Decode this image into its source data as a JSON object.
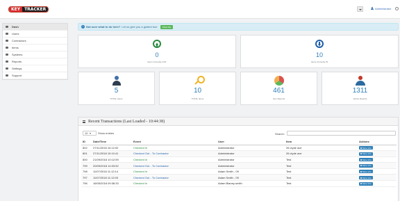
{
  "header": {
    "logo_part1": "KEY",
    "logo_part2": "TRACKER",
    "user": "Administrator"
  },
  "sidebar": {
    "items": [
      {
        "label": "Dash",
        "icon": "home-icon"
      },
      {
        "label": "Users",
        "icon": "user-icon"
      },
      {
        "label": "Contractors",
        "icon": "contractor-icon"
      },
      {
        "label": "Items",
        "icon": "key-icon"
      },
      {
        "label": "Systems",
        "icon": "systems-icon"
      },
      {
        "label": "Reports",
        "icon": "reports-icon"
      },
      {
        "label": "Settings",
        "icon": "settings-icon"
      },
      {
        "label": "Support",
        "icon": "support-icon"
      }
    ]
  },
  "alert": {
    "bold": "Not sure what to do here?",
    "text": "Let us give you a guided tour",
    "button": "Show Me"
  },
  "stats_top": [
    {
      "value": "0",
      "label": "Items Currently OUT"
    },
    {
      "value": "10",
      "label": "Items Currently IN"
    }
  ],
  "stats_mid": [
    {
      "value": "5",
      "label": "TOTAL Users"
    },
    {
      "value": "10",
      "label": "TOTAL Items"
    },
    {
      "value": "461",
      "label": "Item Reports"
    },
    {
      "value": "1311",
      "label": "Admin Reports"
    }
  ],
  "transactions": {
    "title": "Recent Transactions (Last Loaded - 10:44:38)",
    "page_size": "10",
    "show_entries": "Show entries",
    "search_label": "Search:",
    "columns": [
      "ID",
      "Date/Time",
      "Event",
      "User",
      "Item",
      "Actions"
    ],
    "more_label": "More Info",
    "rows": [
      {
        "id": "802",
        "dt": "27/11/2018 10:12:02",
        "event": "Checked In",
        "user": "Administrator",
        "item": "26 clyde ave"
      },
      {
        "id": "801",
        "dt": "27/11/2018 10:10:41",
        "event": "Checked Out - To Contractor",
        "user": "Administrator",
        "item": "26 clyde ave"
      },
      {
        "id": "800",
        "dt": "21/09/2018 10:12:59",
        "event": "Checked In",
        "user": "Administrator",
        "item": "Test"
      },
      {
        "id": "799",
        "dt": "20/09/2018 14:03:52",
        "event": "Checked Out - To Contractor",
        "user": "Administrator",
        "item": "Test"
      },
      {
        "id": "798",
        "dt": "11/07/2018 11:12:14",
        "event": "Checked In",
        "user": "Adam Smith - 09",
        "item": "Test"
      },
      {
        "id": "797",
        "dt": "11/07/2018 11:12:03",
        "event": "Checked Out - To Contractor",
        "user": "Adam Smith - 09",
        "item": "Test"
      },
      {
        "id": "796",
        "dt": "16/05/2018 09:38:33",
        "event": "Checked In",
        "user": "Adam Blaney-smith",
        "item": "Test"
      }
    ]
  }
}
